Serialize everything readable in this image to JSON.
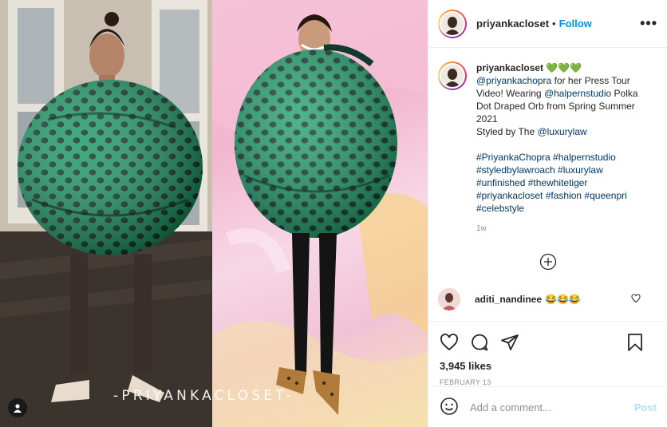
{
  "post": {
    "username": "priyankacloset",
    "follow_label": "Follow",
    "more_icon": "more-options-icon",
    "watermark": "-PRIYANKACLOSET-"
  },
  "caption": {
    "username": "priyankacloset",
    "hearts": "💚💚💚",
    "mention1": "@priyankachopra",
    "t1": " for her Press Tour Video! Wearing ",
    "mention2": "@halpernstudio",
    "t2": " Polka Dot Draped Orb from Spring Summer 2021",
    "t3": "Styled by The ",
    "mention3": "@luxurylaw",
    "hashtags_line1": "#PriyankaChopra #halpernstudio",
    "hashtags_line2": "#styledbylawroach #luxurylaw",
    "hashtags_line3": "#unfinished #thewhitetiger",
    "hashtags_line4": "#priyankacloset #fashion #queenpri",
    "hashtags_line5": "#celebstyle",
    "time": "1w"
  },
  "comment": {
    "username": "aditi_nandinee",
    "text": "😂😂😂"
  },
  "stats": {
    "likes": "3,945 likes",
    "date": "FEBRUARY 13"
  },
  "add_comment": {
    "placeholder": "Add a comment...",
    "post_label": "Post"
  },
  "colors": {
    "follow": "#0095f6",
    "link": "#00376b",
    "dress_green": "#1f8f63",
    "dots": "#123a2c"
  }
}
